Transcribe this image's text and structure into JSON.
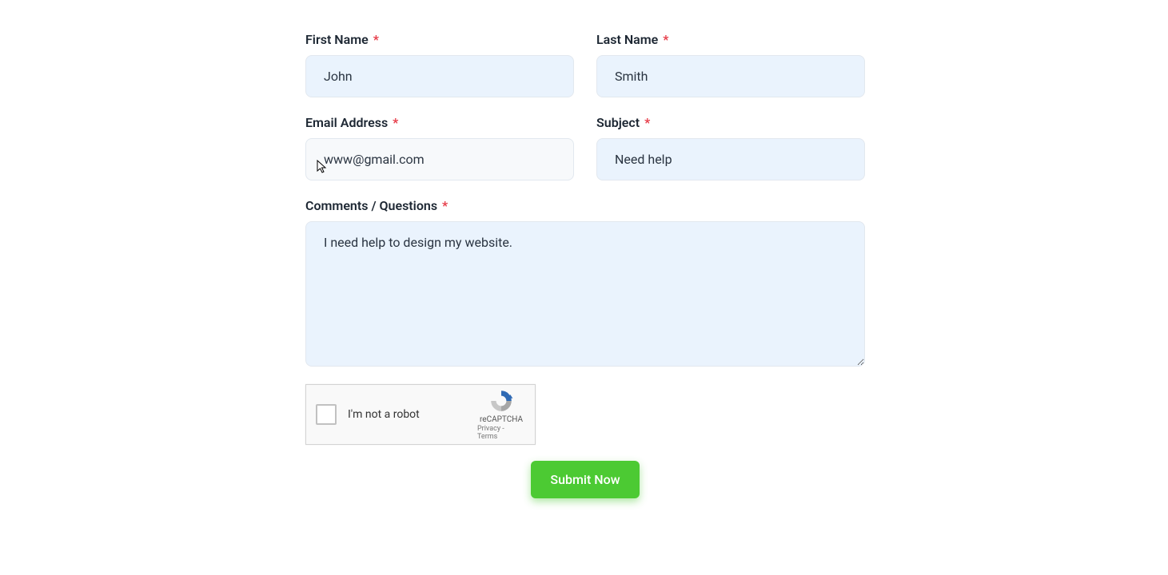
{
  "fields": {
    "first_name": {
      "label": "First Name",
      "value": "John"
    },
    "last_name": {
      "label": "Last Name",
      "value": "Smith"
    },
    "email": {
      "label": "Email Address",
      "value": "www@gmail.com"
    },
    "subject": {
      "label": "Subject",
      "value": "Need help"
    },
    "comments": {
      "label": "Comments / Questions",
      "value": "I need help to design my website."
    }
  },
  "required_marker": "*",
  "captcha": {
    "label": "I'm not a robot",
    "brand": "reCAPTCHA",
    "privacy": "Privacy",
    "separator": " - ",
    "terms": "Terms"
  },
  "submit_label": "Submit Now"
}
